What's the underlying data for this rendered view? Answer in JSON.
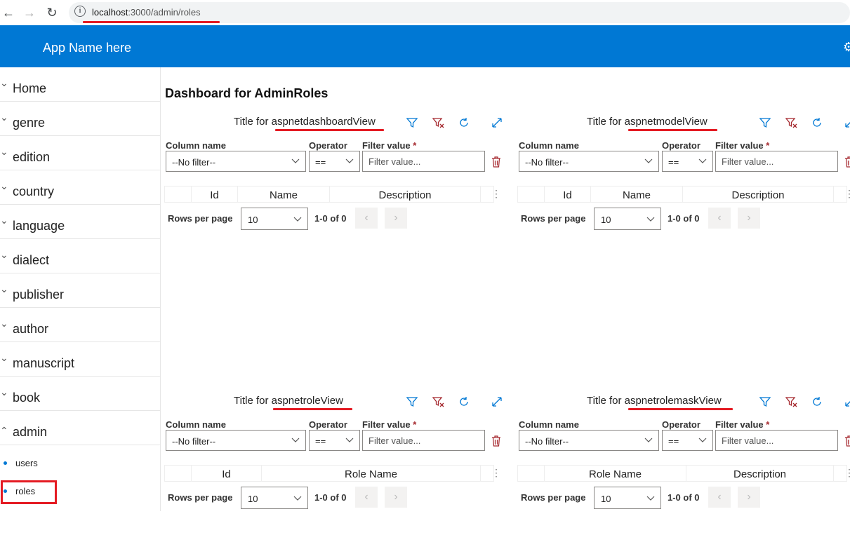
{
  "browser": {
    "url_host": "localhost",
    "url_path": ":3000/admin/roles"
  },
  "app": {
    "name": "App Name here"
  },
  "sidebar": {
    "items": [
      {
        "label": "Home"
      },
      {
        "label": "genre"
      },
      {
        "label": "edition"
      },
      {
        "label": "country"
      },
      {
        "label": "language"
      },
      {
        "label": "dialect"
      },
      {
        "label": "publisher"
      },
      {
        "label": "author"
      },
      {
        "label": "manuscript"
      },
      {
        "label": "book"
      },
      {
        "label": "admin"
      }
    ],
    "subitems": [
      {
        "label": "users"
      },
      {
        "label": "roles"
      }
    ]
  },
  "main": {
    "title": "Dashboard for AdminRoles",
    "filter_labels": {
      "column": "Column name",
      "operator": "Operator",
      "value": "Filter value",
      "required": "*"
    },
    "no_filter": "--No filter--",
    "operator_value": "==",
    "filter_placeholder": "Filter value...",
    "rows_per_page_label": "Rows per page",
    "rows_per_page_value": "10",
    "range": "1-0 of 0",
    "panels": [
      {
        "title_prefix": "Title for",
        "view": "aspnetdashboardView",
        "columns": [
          "Id",
          "Name",
          "Description"
        ]
      },
      {
        "title_prefix": "Title for",
        "view": "aspnetmodelView",
        "columns": [
          "Id",
          "Name",
          "Description"
        ]
      },
      {
        "title_prefix": "Title for",
        "view": "aspnetroleView",
        "columns": [
          "Id",
          "Role Name"
        ]
      },
      {
        "title_prefix": "Title for",
        "view": "aspnetrolemaskView",
        "columns": [
          "Role Name",
          "Description"
        ]
      }
    ]
  },
  "colors": {
    "accent": "#0078d4",
    "danger": "#a4262c",
    "annotation": "#e41b23"
  }
}
